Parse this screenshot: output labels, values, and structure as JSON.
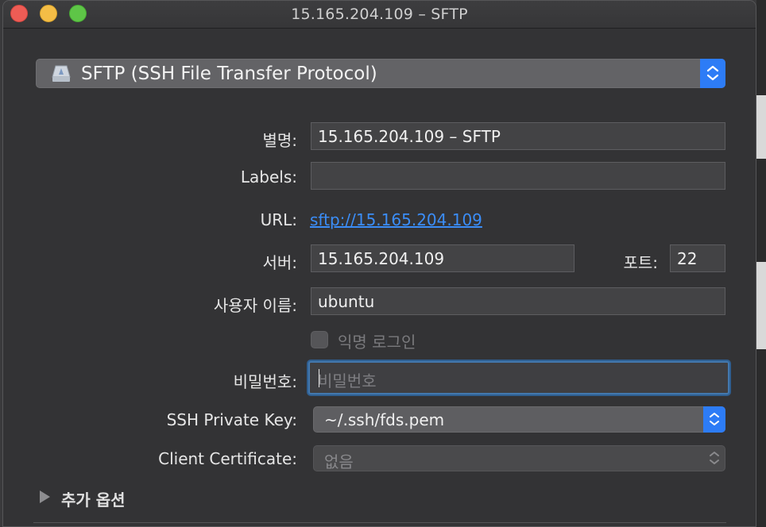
{
  "window": {
    "title": "15.165.204.109 – SFTP"
  },
  "protocol": {
    "selected": "SFTP (SSH File Transfer Protocol)",
    "icon": "drive-icon"
  },
  "form": {
    "nickname": {
      "label": "별명:",
      "value": "15.165.204.109 – SFTP"
    },
    "labels": {
      "label": "Labels:",
      "value": ""
    },
    "url": {
      "label": "URL:",
      "value": "sftp://15.165.204.109"
    },
    "server": {
      "label": "서버:",
      "value": "15.165.204.109"
    },
    "port": {
      "label": "포트:",
      "value": "22"
    },
    "username": {
      "label": "사용자 이름:",
      "value": "ubuntu"
    },
    "anonymous": {
      "label": "익명 로그인",
      "checked": false
    },
    "password": {
      "label": "비밀번호:",
      "placeholder": "비밀번호",
      "value": ""
    },
    "ssh_key": {
      "label": "SSH Private Key:",
      "value": "~/.ssh/fds.pem"
    },
    "client_cert": {
      "label": "Client Certificate:",
      "value": "없음"
    }
  },
  "more_options": {
    "label": "추가 옵션"
  },
  "colors": {
    "accent": "#2d7cf6",
    "link": "#3b8df7",
    "focus_ring": "#4378ae"
  }
}
